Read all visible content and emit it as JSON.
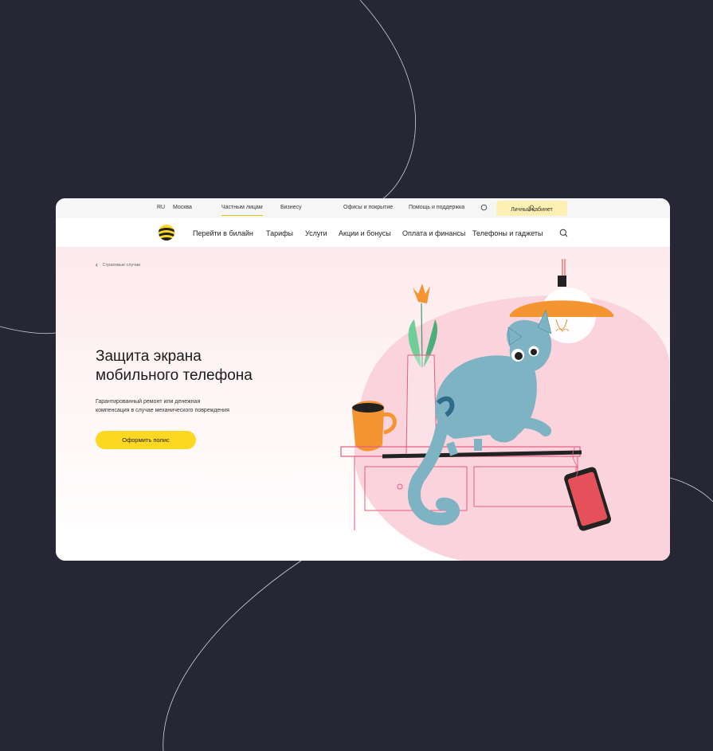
{
  "topbar": {
    "lang": "RU",
    "city": "Москва",
    "private": "Частным лицам",
    "business": "Бизнесу",
    "offices": "Офисы и покрытие",
    "help": "Помощь и поддержка",
    "cabinet": "Личный кабинет"
  },
  "nav": {
    "items": [
      "Перейти в билайн",
      "Тарифы",
      "Услуги",
      "Акции и бонусы",
      "Оплата и финансы",
      "Телефоны и гаджеты"
    ]
  },
  "hero": {
    "breadcrumb": "Страховые случаи",
    "title_line1": "Защита экрана",
    "title_line2": "мобильного телефона",
    "subtitle_line1": "Гарантированный ремонт или денежная",
    "subtitle_line2": "компенсация в случае механического повреждения",
    "cta": "Оформить полис"
  },
  "colors": {
    "background": "#272635",
    "accent": "#fcd823",
    "cabinet_bg": "#fdf0b2"
  },
  "icons": [
    "search-icon",
    "user-icon",
    "chevron-left-icon",
    "beeline-logo"
  ]
}
